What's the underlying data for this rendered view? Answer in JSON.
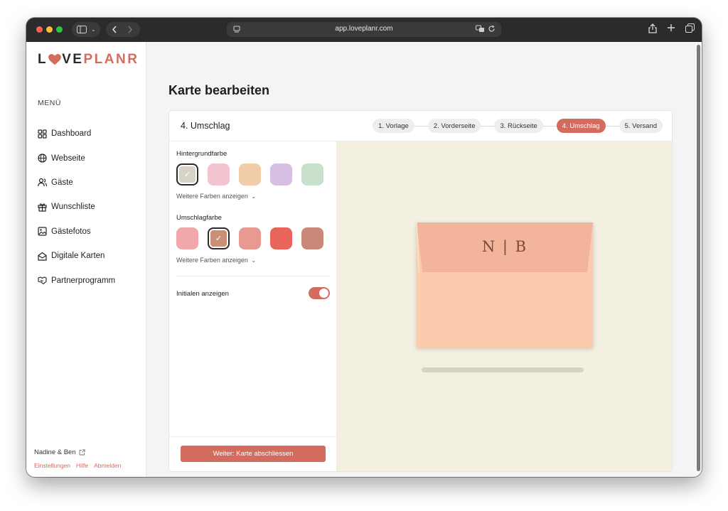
{
  "browser": {
    "url": "app.loveplanr.com"
  },
  "brand": {
    "logo_l": "L",
    "logo_ve": "VE",
    "logo_planr": "PLANR",
    "accent": "#d36c5f"
  },
  "sidebar": {
    "menu_label": "MENÜ",
    "items": [
      {
        "label": "Dashboard",
        "icon": "dashboard-icon"
      },
      {
        "label": "Webseite",
        "icon": "globe-icon"
      },
      {
        "label": "Gäste",
        "icon": "users-icon"
      },
      {
        "label": "Wunschliste",
        "icon": "gift-icon"
      },
      {
        "label": "Gästefotos",
        "icon": "image-icon"
      },
      {
        "label": "Digitale Karten",
        "icon": "envelope-open-icon"
      },
      {
        "label": "Partnerprogramm",
        "icon": "handshake-icon"
      }
    ],
    "user_name": "Nadine & Ben",
    "links": [
      "Einstellungen",
      "Hilfe",
      "Abmelden"
    ]
  },
  "page": {
    "title": "Karte bearbeiten"
  },
  "editor": {
    "step_title": "4. Umschlag",
    "steps": [
      "1. Vorlage",
      "2. Vorderseite",
      "3. Rückseite",
      "4. Umschlag",
      "5. Versand"
    ],
    "active_step": 3,
    "background_label": "Hintergrundfarbe",
    "background_colors": [
      "#d8d3c9",
      "#f1c4cf",
      "#f0cda8",
      "#d7bfe3",
      "#c8e0cc"
    ],
    "background_selected": 0,
    "envelope_label": "Umschlagfarbe",
    "envelope_colors": [
      "#f2a8a8",
      "#c98f78",
      "#e59a93",
      "#e9645a",
      "#c98878"
    ],
    "envelope_selected": 1,
    "more_colors": "Weitere Farben anzeigen",
    "initials_label": "Initialen anzeigen",
    "initials_on": true,
    "cta": "Weiter: Karte abschliessen"
  },
  "preview": {
    "initials": "N | B",
    "envelope_color": "#fbcbad",
    "flap_color": "#f2b59b",
    "background": "#f3f0e1"
  }
}
